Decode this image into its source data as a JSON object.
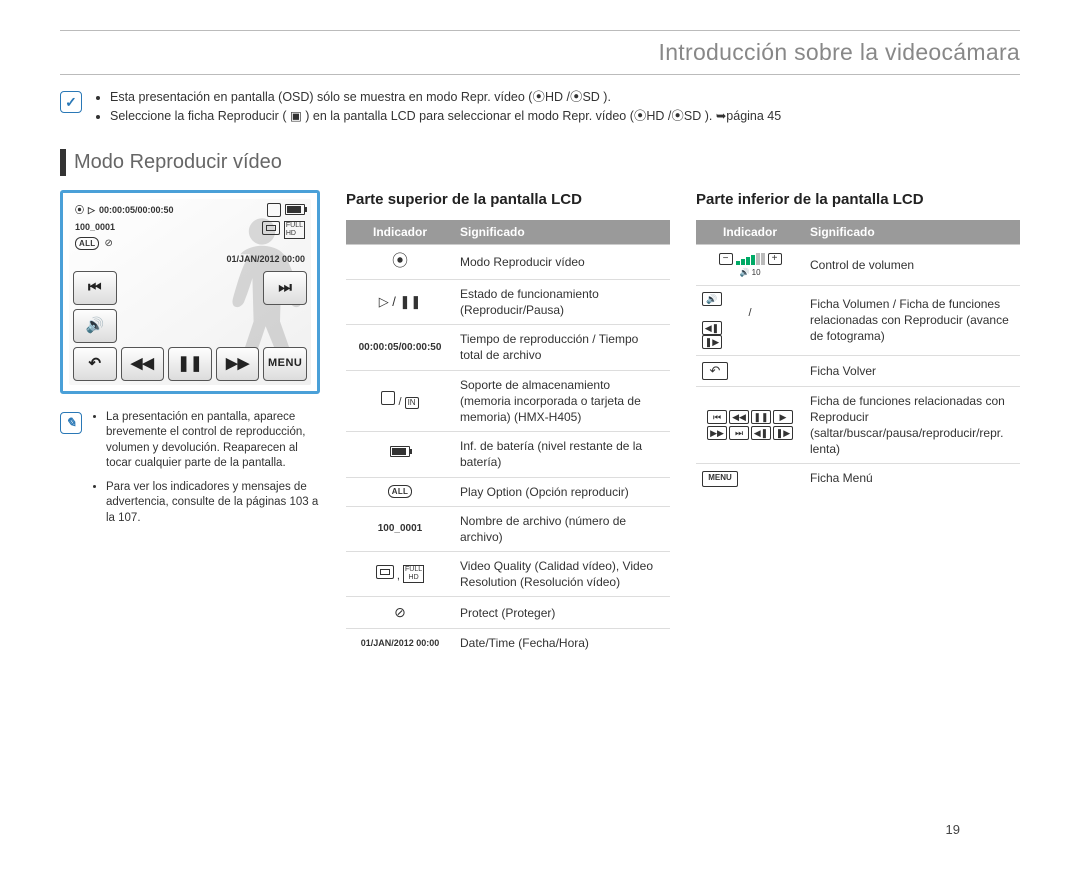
{
  "page": {
    "title": "Introducción sobre la videocámara",
    "number": "19"
  },
  "intro": {
    "bullets": [
      "Esta presentación en pantalla (OSD) sólo se muestra en modo Repr. vídeo (⦿HD /⦿SD ).",
      "Seleccione la ficha Reproducir ( ▣ ) en la pantalla LCD para seleccionar el modo Repr. vídeo (⦿HD /⦿SD ). ➥página 45"
    ]
  },
  "section_heading": "Modo Reproducir vídeo",
  "lcd": {
    "time": "00:00:05/00:00:50",
    "file": "100_0001",
    "date": "01/JAN/2012 00:00",
    "menu_label": "MENU"
  },
  "notes": {
    "bullets": [
      "La presentación en pantalla, aparece brevemente el control de reproducción, volumen y devolución. Reaparecen al tocar cualquier parte de la pantalla.",
      "Para ver los indicadores y mensajes de advertencia, consulte de la páginas 103 a la 107."
    ]
  },
  "top_table": {
    "heading": "Parte superior de la pantalla LCD",
    "col1": "Indicador",
    "col2": "Significado",
    "rows": [
      {
        "ind_text": "",
        "ind_type": "video-mode",
        "meaning": "Modo Reproducir vídeo"
      },
      {
        "ind_text": "▷ / ❚❚",
        "ind_type": "play-pause",
        "meaning": "Estado de funcionamiento (Reproducir/Pausa)"
      },
      {
        "ind_text": "00:00:05/00:00:50",
        "ind_type": "text-bold",
        "meaning": "Tiempo de reproducción / Tiempo total de archivo"
      },
      {
        "ind_text": "",
        "ind_type": "storage",
        "meaning": "Soporte de almacenamiento (memoria incorporada o tarjeta de memoria) (HMX-H405)"
      },
      {
        "ind_text": "",
        "ind_type": "battery",
        "meaning": "Inf. de batería (nivel restante de la batería)"
      },
      {
        "ind_text": "ALL",
        "ind_type": "all",
        "meaning": "Play Option (Opción reproducir)"
      },
      {
        "ind_text": "100_0001",
        "ind_type": "text-bold",
        "meaning": "Nombre de archivo (número de archivo)"
      },
      {
        "ind_text": "",
        "ind_type": "quality",
        "meaning": "Video Quality (Calidad vídeo), Video Resolution (Resolución vídeo)"
      },
      {
        "ind_text": "",
        "ind_type": "protect",
        "meaning": "Protect (Proteger)"
      },
      {
        "ind_text": "01/JAN/2012 00:00",
        "ind_type": "text-bold-sm",
        "meaning": "Date/Time (Fecha/Hora)"
      }
    ]
  },
  "bottom_table": {
    "heading": "Parte inferior de la pantalla LCD",
    "col1": "Indicador",
    "col2": "Significado",
    "rows": [
      {
        "ind_type": "volume",
        "meaning": "Control de volumen"
      },
      {
        "ind_type": "vol-frame",
        "meaning": "Ficha Volumen / Ficha de funciones relacionadas con Reproducir (avance de fotograma)"
      },
      {
        "ind_type": "back",
        "meaning": "Ficha Volver"
      },
      {
        "ind_type": "playbar",
        "meaning": "Ficha de funciones relacionadas con Reproducir (saltar/buscar/pausa/reproducir/repr. lenta)"
      },
      {
        "ind_type": "menu",
        "ind_text": "MENU",
        "meaning": "Ficha Menú"
      }
    ]
  }
}
